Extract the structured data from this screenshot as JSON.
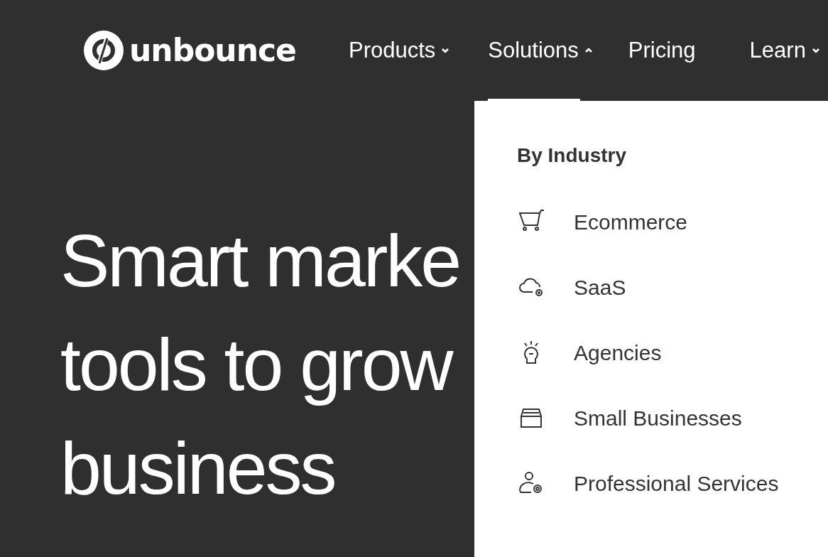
{
  "logo": {
    "text": "unbounce"
  },
  "nav": [
    {
      "label": "Products",
      "expanded": false
    },
    {
      "label": "Solutions",
      "expanded": true
    },
    {
      "label": "Pricing"
    },
    {
      "label": "Learn",
      "expanded": false
    }
  ],
  "hero": {
    "lines": [
      "Smart marke",
      "tools to grow",
      "business"
    ]
  },
  "dropdown": {
    "heading": "By Industry",
    "items": [
      {
        "label": "Ecommerce",
        "kind": "cart"
      },
      {
        "label": "SaaS",
        "kind": "cloud"
      },
      {
        "label": "Agencies",
        "kind": "bulb"
      },
      {
        "label": "Small Businesses",
        "kind": "store"
      },
      {
        "label": "Professional Services",
        "kind": "person"
      }
    ]
  }
}
